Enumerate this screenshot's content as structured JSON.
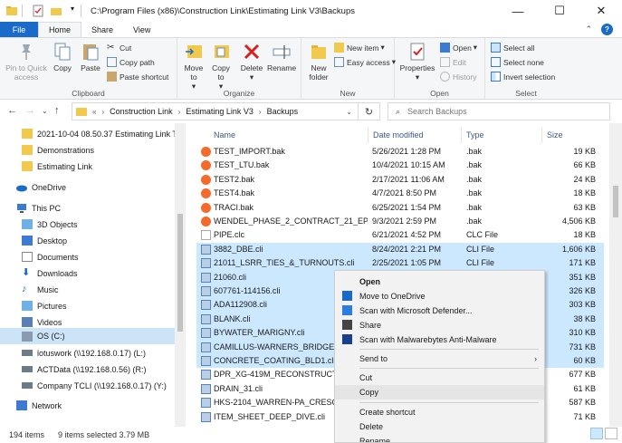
{
  "window": {
    "title": "C:\\Program Files (x86)\\Construction Link\\Estimating Link V3\\Backups",
    "minimize": "—",
    "maximize": "☐",
    "close": "✕"
  },
  "ribbon_tabs": [
    "File",
    "Home",
    "Share",
    "View"
  ],
  "ribbon": {
    "clipboard": {
      "label": "Clipboard",
      "pin": "Pin to Quick access",
      "copy": "Copy",
      "paste": "Paste",
      "cut": "Cut",
      "copy_path": "Copy path",
      "paste_shortcut": "Paste shortcut"
    },
    "organize": {
      "label": "Organize",
      "move_to": "Move to",
      "copy_to": "Copy to",
      "delete": "Delete",
      "rename": "Rename"
    },
    "new": {
      "label": "New",
      "new_folder": "New folder",
      "new_item": "New item",
      "easy_access": "Easy access"
    },
    "open": {
      "label": "Open",
      "properties": "Properties",
      "open": "Open",
      "edit": "Edit",
      "history": "History"
    },
    "select": {
      "label": "Select",
      "select_all": "Select all",
      "select_none": "Select none",
      "invert": "Invert selection"
    }
  },
  "address": {
    "prefix": "«",
    "crumbs": [
      "Construction Link",
      "Estimating Link V3",
      "Backups"
    ],
    "search_placeholder": "Search Backups"
  },
  "nav": [
    {
      "label": "2021-10-04 08.50.37 Estimating Link Trai",
      "icon": "folder-icon"
    },
    {
      "label": "Demonstrations",
      "icon": "folder-icon"
    },
    {
      "label": "Estimating Link",
      "icon": "folder-icon"
    },
    {
      "label": "OneDrive",
      "icon": "onedrive-icon"
    },
    {
      "label": "This PC",
      "icon": "pc-icon"
    },
    {
      "label": "3D Objects",
      "icon": "3d-objects-icon"
    },
    {
      "label": "Desktop",
      "icon": "desktop-icon"
    },
    {
      "label": "Documents",
      "icon": "documents-icon"
    },
    {
      "label": "Downloads",
      "icon": "downloads-icon"
    },
    {
      "label": "Music",
      "icon": "music-icon"
    },
    {
      "label": "Pictures",
      "icon": "pictures-icon"
    },
    {
      "label": "Videos",
      "icon": "videos-icon"
    },
    {
      "label": "OS (C:)",
      "icon": "drive-icon"
    },
    {
      "label": "lotuswork (\\\\192.168.0.17) (L:)",
      "icon": "network-drive-icon"
    },
    {
      "label": "ACTData (\\\\192.168.0.56) (R:)",
      "icon": "network-drive-icon"
    },
    {
      "label": "Company TCLI (\\\\192.168.0.17) (Y:)",
      "icon": "network-drive-icon"
    },
    {
      "label": "Network",
      "icon": "network-icon"
    }
  ],
  "columns": [
    "Name",
    "Date modified",
    "Type",
    "Size"
  ],
  "files": [
    {
      "name": "TEST_IMPORT.bak",
      "date": "5/26/2021 1:28 PM",
      "type": ".bak",
      "size": "19 KB",
      "kind": "bak"
    },
    {
      "name": "TEST_LTU.bak",
      "date": "10/4/2021 10:15 AM",
      "type": ".bak",
      "size": "66 KB",
      "kind": "bak"
    },
    {
      "name": "TEST2.bak",
      "date": "2/17/2021 11:06 AM",
      "type": ".bak",
      "size": "24 KB",
      "kind": "bak"
    },
    {
      "name": "TEST4.bak",
      "date": "4/7/2021 8:50 PM",
      "type": ".bak",
      "size": "18 KB",
      "kind": "bak"
    },
    {
      "name": "TRACI.bak",
      "date": "6/25/2021 1:54 PM",
      "type": ".bak",
      "size": "63 KB",
      "kind": "bak"
    },
    {
      "name": "WENDEL_PHASE_2_CONTRACT_21_EPC.b...",
      "date": "9/3/2021 2:59 PM",
      "type": ".bak",
      "size": "4,506 KB",
      "kind": "bak"
    },
    {
      "name": "PIPE.clc",
      "date": "6/21/2021 4:52 PM",
      "type": "CLC File",
      "size": "18 KB",
      "kind": "clc"
    },
    {
      "name": "3882_DBE.cli",
      "date": "8/24/2021 2:21 PM",
      "type": "CLI File",
      "size": "1,606 KB",
      "kind": "cli",
      "selected": true
    },
    {
      "name": "21011_LSRR_TIES_&_TURNOUTS.cli",
      "date": "2/25/2021 1:05 PM",
      "type": "CLI File",
      "size": "171 KB",
      "kind": "cli",
      "selected": true
    },
    {
      "name": "21060.cli",
      "date": "",
      "type": "",
      "size": "351 KB",
      "kind": "cli",
      "selected": true
    },
    {
      "name": "607761-114156.cli",
      "date": "",
      "type": "",
      "size": "326 KB",
      "kind": "cli",
      "selected": true
    },
    {
      "name": "ADA112908.cli",
      "date": "",
      "type": "",
      "size": "303 KB",
      "kind": "cli",
      "selected": true
    },
    {
      "name": "BLANK.cli",
      "date": "",
      "type": "",
      "size": "38 KB",
      "kind": "cli",
      "selected": true
    },
    {
      "name": "BYWATER_MARIGNY.cli",
      "date": "",
      "type": "",
      "size": "310 KB",
      "kind": "cli",
      "selected": true
    },
    {
      "name": "CAMILLUS-WARNERS_BRIDGE.cli",
      "date": "",
      "type": "",
      "size": "731 KB",
      "kind": "cli",
      "selected": true
    },
    {
      "name": "CONCRETE_COATING_BLD1.cli",
      "date": "",
      "type": "",
      "size": "60 KB",
      "kind": "cli",
      "selected": true
    },
    {
      "name": "DPR_XG-419M_RECONSTRUCTION_",
      "date": "",
      "type": "",
      "size": "677 KB",
      "kind": "cli"
    },
    {
      "name": "DRAIN_31.cli",
      "date": "",
      "type": "",
      "size": "61 KB",
      "kind": "cli"
    },
    {
      "name": "HKS-2104_WARREN-PA_CRESCENT",
      "date": "",
      "type": "",
      "size": "587 KB",
      "kind": "cli"
    },
    {
      "name": "ITEM_SHEET_DEEP_DIVE.cli",
      "date": "",
      "type": "",
      "size": "71 KB",
      "kind": "cli"
    }
  ],
  "status": {
    "items": "194 items",
    "selected": "9 items selected  3.79 MB"
  },
  "context_menu": [
    {
      "label": "Open",
      "bold": true
    },
    {
      "label": "Move to OneDrive",
      "icon": "onedrive-icon"
    },
    {
      "label": "Scan with Microsoft Defender...",
      "icon": "defender-icon"
    },
    {
      "label": "Share",
      "icon": "share-icon"
    },
    {
      "label": "Scan with Malwarebytes Anti-Malware",
      "icon": "malwarebytes-icon"
    },
    {
      "label": "Send to",
      "submenu": true
    },
    {
      "label": "Cut"
    },
    {
      "label": "Copy",
      "hover": true
    },
    {
      "label": "Create shortcut"
    },
    {
      "label": "Delete"
    },
    {
      "label": "Rename"
    }
  ],
  "colors": {
    "accent": "#1a6ac9",
    "selection": "#cce8ff",
    "nav_selected": "#cce4f7",
    "bak_icon": "#f36a2a"
  }
}
